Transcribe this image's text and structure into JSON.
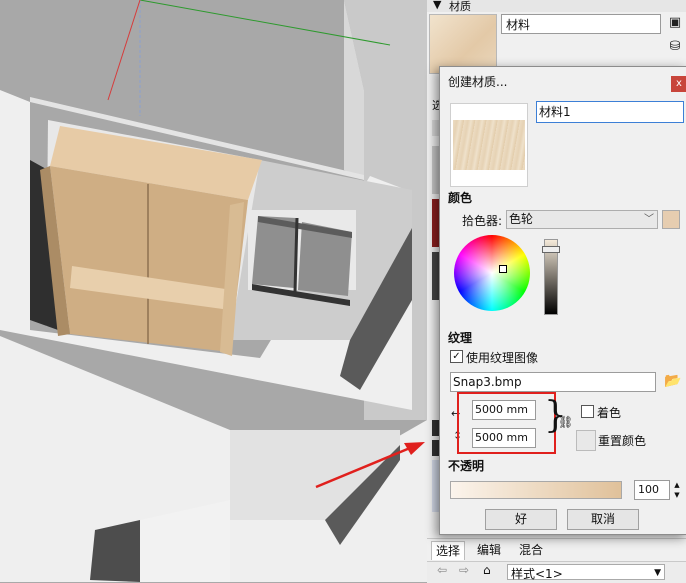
{
  "tray": {
    "title": "材质",
    "material_name": "材料"
  },
  "left_partial": {
    "tab_select": "选"
  },
  "dialog": {
    "title": "创建材质...",
    "close_label": "x",
    "material_name": "材料1",
    "color_section": "颜色",
    "picker_label": "拾色器:",
    "picker_value": "色轮",
    "texture_section": "纹理",
    "use_texture_label": "使用纹理图像",
    "use_texture_checked": true,
    "texture_file": "Snap3.bmp",
    "width_value": "5000 mm",
    "height_value": "5000 mm",
    "colorize_label": "着色",
    "reset_color_label": "重置颜色",
    "opacity_section": "不透明",
    "opacity_value": "100",
    "ok_label": "好",
    "cancel_label": "取消",
    "swatch_color": "#e6cdb0"
  },
  "bottom_tabs": [
    "选择",
    "编辑",
    "混合"
  ],
  "bottom_nav": {
    "style_value": "样式<1>"
  },
  "icons": {
    "tray_toggle": "triangle-down",
    "paint": "paint-bucket",
    "sample": "eyedropper",
    "home": "house",
    "back": "arrow-left",
    "forward": "arrow-right"
  }
}
